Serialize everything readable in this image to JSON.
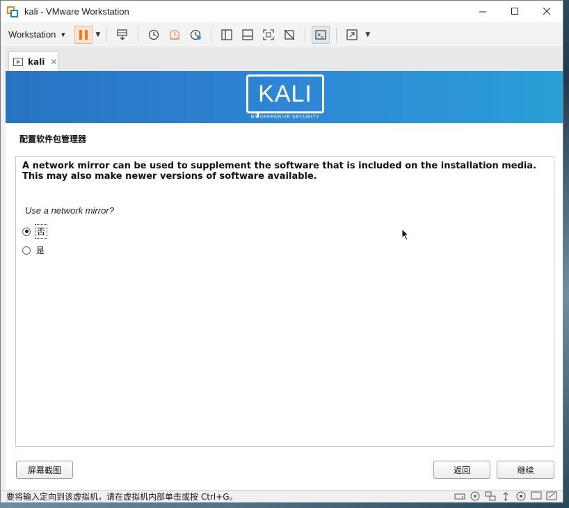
{
  "window": {
    "title": "kali - VMware Workstation"
  },
  "toolbar": {
    "menu_label": "Workstation"
  },
  "tab": {
    "label": "kali"
  },
  "banner": {
    "logo_text": "KALI",
    "logo_subtitle": "BY OFFENSIVE SECURITY"
  },
  "installer": {
    "section_title": "配置软件包管理器",
    "description": "A network mirror can be used to supplement the software that is included on the installation media. This may also make newer versions of software available.",
    "question": "Use a network mirror?",
    "options": [
      {
        "label": "否",
        "selected": true
      },
      {
        "label": "是",
        "selected": false
      }
    ],
    "screenshot_button": "屏幕截图",
    "back_button": "返回",
    "continue_button": "继续"
  },
  "statusbar": {
    "message": "要将输入定向到该虚拟机，请在虚拟机内部单击或按 Ctrl+G。"
  },
  "colors": {
    "banner_start": "#2773c2",
    "banner_end": "#2a9fd6",
    "pause_accent": "#f07a1a"
  }
}
